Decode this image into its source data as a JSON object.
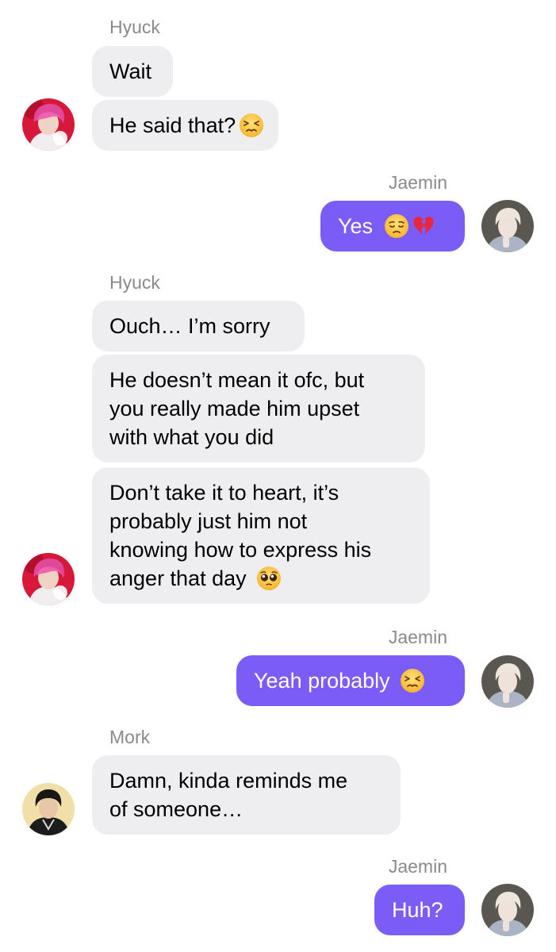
{
  "chat": {
    "group1": {
      "sender": "Hyuck",
      "messages": [
        "Wait",
        "He said that?"
      ]
    },
    "group2": {
      "sender": "Jaemin",
      "messages": [
        "Yes"
      ]
    },
    "group3": {
      "sender": "Hyuck",
      "messages": [
        "Ouch… I’m sorry",
        [
          "He doesn’t mean it ofc, but",
          "you really made him upset",
          "with what you did"
        ],
        [
          "Don’t take it to heart, it’s",
          "probably just him not",
          "knowing how to express his",
          "anger that day"
        ]
      ]
    },
    "group4": {
      "sender": "Jaemin",
      "messages": [
        "Yeah probably"
      ]
    },
    "group5": {
      "sender": "Mork",
      "messages": [
        [
          "Damn, kinda reminds me",
          "of someone…"
        ]
      ]
    },
    "group6": {
      "sender": "Jaemin",
      "messages": [
        "Huh?"
      ]
    }
  },
  "emojis": {
    "persevering": "persevering-face-icon",
    "pensive": "pensive-face-icon",
    "broken_heart": "broken-heart-icon",
    "pleading": "pleading-face-icon"
  },
  "colors": {
    "outgoing_bubble": "#7b5cf6",
    "incoming_bubble": "#eeeef0",
    "sender_name": "#8a8a8e"
  }
}
